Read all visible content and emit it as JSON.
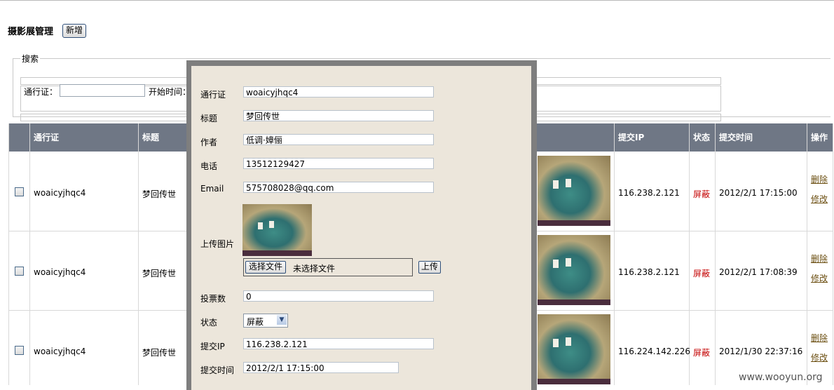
{
  "page": {
    "title": "摄影展管理",
    "add_button": "新增"
  },
  "search": {
    "legend": "搜索",
    "pass_label": "通行证：",
    "start_label": "开始时间："
  },
  "table": {
    "columns": [
      "通行证",
      "标题",
      "提交IP",
      "状态",
      "提交时间",
      "操作"
    ],
    "rows": [
      {
        "pass": "woaicyjhqc4",
        "title": "梦回传世",
        "ip": "116.238.2.121",
        "status": "屏蔽",
        "time": "2012/2/1 17:15:00",
        "op_delete": "删除",
        "op_edit": "修改"
      },
      {
        "pass": "woaicyjhqc4",
        "title": "梦回传世",
        "ip": "116.238.2.121",
        "status": "屏蔽",
        "time": "2012/2/1 17:08:39",
        "op_delete": "删除",
        "op_edit": "修改"
      },
      {
        "pass": "woaicyjhqc4",
        "title": "梦回传世",
        "ip": "116.224.142.226",
        "status": "屏蔽",
        "time": "2012/1/30 22:37:16",
        "op_delete": "删除",
        "op_edit": "修改"
      }
    ]
  },
  "modal": {
    "pass": {
      "label": "通行证",
      "value": "woaicyjhqc4"
    },
    "title": {
      "label": "标题",
      "value": "梦回传世"
    },
    "author": {
      "label": "作者",
      "value": "低调·嫜俪"
    },
    "phone": {
      "label": "电话",
      "value": "13512129427"
    },
    "email": {
      "label": "Email",
      "value": "575708028@qq.com"
    },
    "upload": {
      "label": "上传图片",
      "choose_button": "选择文件",
      "no_file": "未选择文件",
      "upload_button": "上传"
    },
    "votes": {
      "label": "投票数",
      "value": "0"
    },
    "status": {
      "label": "状态",
      "value": "屏蔽"
    },
    "ip": {
      "label": "提交IP",
      "value": "116.238.2.121"
    },
    "time": {
      "label": "提交时间",
      "value": "2012/2/1 17:15:00"
    }
  },
  "watermark": "www.wooyun.org"
}
